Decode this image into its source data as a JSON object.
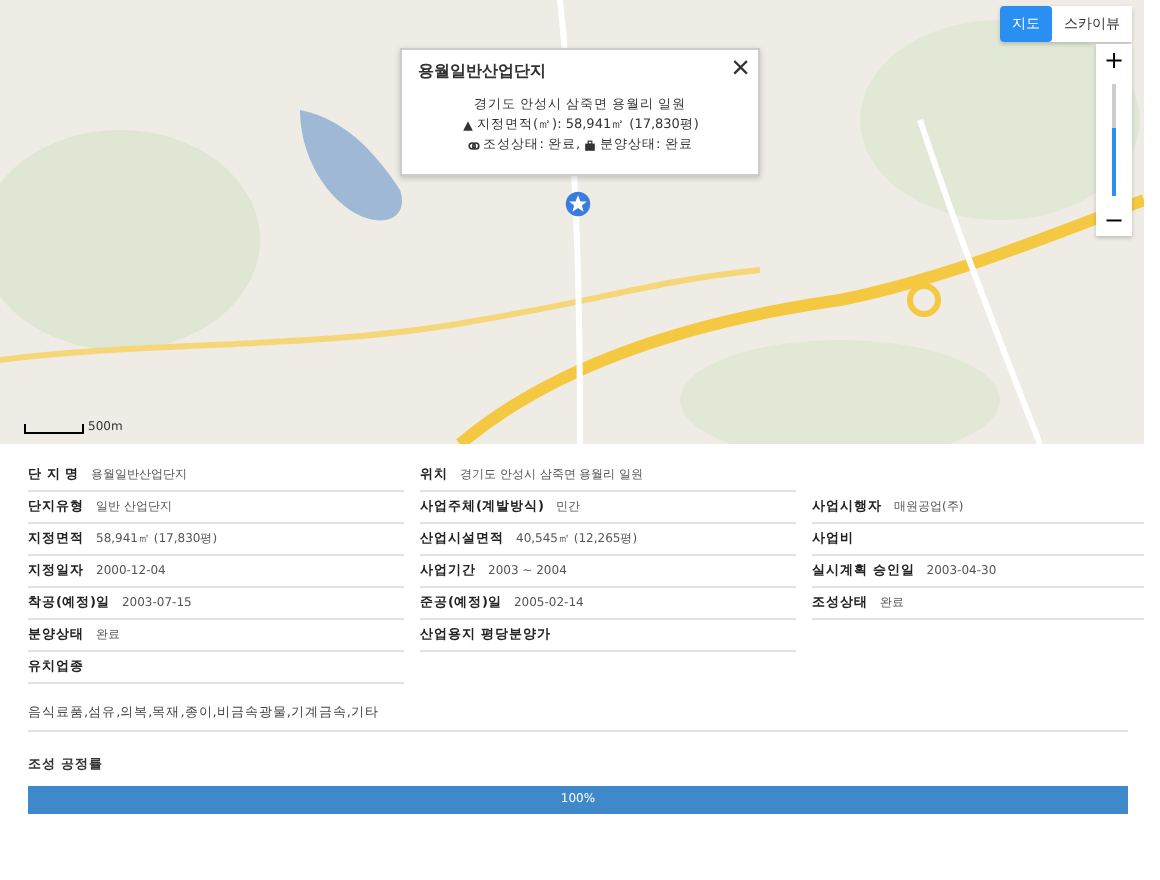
{
  "map": {
    "map_types": [
      {
        "label": "지도",
        "selected": true
      },
      {
        "label": "스카이뷰",
        "selected": false
      }
    ],
    "zoom": {
      "in": "+",
      "out": "−",
      "level": 0.6
    },
    "scale": "500m",
    "popup": {
      "title": "용월일반산업단지",
      "close": "×",
      "lines": [
        "경기도 안성시 삼죽면 용월리 일원",
        "지정면적(㎡): 58,941㎡ (17,830평)"
      ],
      "status": [
        {
          "text": "조성상태: 완료,"
        },
        {
          "text": "분양상태: 완료"
        }
      ]
    }
  },
  "info_columns": [
    [
      {
        "label": "단 지 명",
        "value": "용월일반산업단지"
      },
      {
        "label": "단지유형",
        "value": "일반 산업단지"
      },
      {
        "label": "지정면적",
        "value": "58,941㎡ (17,830평)"
      },
      {
        "label": "지정일자",
        "value": "2000-12-04"
      },
      {
        "label": "착공(예정)일",
        "value": "2003-07-15"
      },
      {
        "label": "분양상태",
        "value": "완료"
      },
      {
        "label": "유치업종"
      }
    ],
    [
      {
        "label": "위치",
        "value": "경기도 안성시 삼죽면 용월리 일원"
      },
      {
        "label": "사업주체(계발방식)",
        "value": "민간"
      },
      {
        "label": "산업시설면적",
        "value": "40,545㎡ (12,265평)"
      },
      {
        "label": "사업기간",
        "value": "2003 ~ 2004"
      },
      {
        "label": "준공(예정)일",
        "value": "2005-02-14"
      },
      {
        "label": "산업용지 평당분양가"
      }
    ],
    [
      {
        "label": "사업시행자",
        "value": "매원공업(주)"
      },
      {
        "label": "사업비"
      },
      {
        "label": "실시계획 승인일",
        "value": "2003-04-30"
      },
      {
        "label": "조성상태",
        "value": "완료"
      }
    ]
  ],
  "industries": "음식료품,섬유,의복,목재,종이,비금속광물,기계금속,기타",
  "progress": {
    "title": "조성 공정률",
    "level": 1,
    "reading": "100%"
  }
}
